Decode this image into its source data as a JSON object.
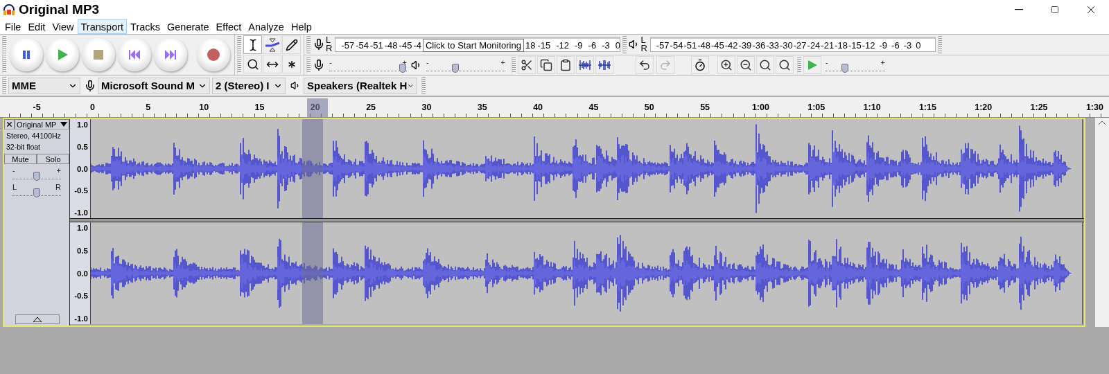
{
  "window": {
    "title": "Original MP3"
  },
  "menu": [
    {
      "label": "File",
      "selected": false
    },
    {
      "label": "Edit",
      "selected": false
    },
    {
      "label": "View",
      "selected": false
    },
    {
      "label": "Transport",
      "selected": true
    },
    {
      "label": "Tracks",
      "selected": false
    },
    {
      "label": "Generate",
      "selected": false
    },
    {
      "label": "Effect",
      "selected": false
    },
    {
      "label": "Analyze",
      "selected": false
    },
    {
      "label": "Help",
      "selected": false
    }
  ],
  "transport": [
    {
      "kind": "pause"
    },
    {
      "kind": "play"
    },
    {
      "kind": "stop"
    },
    {
      "kind": "skip-start"
    },
    {
      "kind": "skip-end"
    },
    {
      "kind": "record"
    }
  ],
  "tools": [
    {
      "kind": "select",
      "selected": true
    },
    {
      "kind": "envelope",
      "selected": false
    },
    {
      "kind": "draw",
      "selected": false
    },
    {
      "kind": "zoom",
      "selected": false
    },
    {
      "kind": "time-shift",
      "selected": false
    },
    {
      "kind": "multi",
      "selected": false
    }
  ],
  "record_meter": {
    "left": "L",
    "right": "R",
    "scale_before": [
      "-57",
      "-54",
      "-51",
      "-48",
      "-45",
      "-4"
    ],
    "tooltip": "Click to Start Monitoring",
    "scale_after": [
      "18",
      "-15",
      "-12",
      "-9",
      "-6",
      "-3",
      "0"
    ]
  },
  "playback_meter": {
    "left": "L",
    "right": "R",
    "scale": [
      "-57",
      "-54",
      "-51",
      "-48",
      "-45",
      "-42",
      "-39",
      "-36",
      "-33",
      "-30",
      "-27",
      "-24",
      "-21",
      "-18",
      "-15",
      "-12",
      "-9",
      "-6",
      "-3",
      "0"
    ]
  },
  "record_volume": {
    "min": "-",
    "max": "+",
    "level": 0.95
  },
  "playback_volume": {
    "min": "-",
    "max": "+",
    "level": 0.37
  },
  "edit_tools": [
    {
      "kind": "cut",
      "disabled": false
    },
    {
      "kind": "copy",
      "disabled": false
    },
    {
      "kind": "paste",
      "disabled": false
    },
    {
      "kind": "trim",
      "disabled": false
    },
    {
      "kind": "silence",
      "disabled": false
    }
  ],
  "history": [
    {
      "kind": "undo",
      "disabled": false
    },
    {
      "kind": "redo",
      "disabled": true
    }
  ],
  "zoom_tools": [
    {
      "kind": "zoom-in"
    },
    {
      "kind": "zoom-out"
    },
    {
      "kind": "fit-selection"
    },
    {
      "kind": "fit-project"
    }
  ],
  "play_at_speed": {
    "min": "-",
    "max": "+",
    "level": 0.33
  },
  "devices": {
    "host": "MME",
    "input": "Microsoft Sound M",
    "channels": "2 (Stereo) I",
    "output": "Speakers (Realtek H"
  },
  "timeline": {
    "labels": [
      "-5",
      "0",
      "5",
      "10",
      "15",
      "20",
      "25",
      "30",
      "35",
      "40",
      "45",
      "50",
      "55",
      "1:00",
      "1:05",
      "1:10",
      "1:15",
      "1:20",
      "1:25",
      "1:30"
    ]
  },
  "track": {
    "name": "Original MP",
    "info": [
      "Stereo, 44100Hz",
      "32-bit float"
    ],
    "mute": "Mute",
    "solo": "Solo",
    "gain": {
      "min": "-",
      "max": "+",
      "level": 0.5
    },
    "pan": {
      "min": "L",
      "max": "R",
      "level": 0.5
    },
    "channels": [
      {
        "scale": [
          "1.0",
          "0.5",
          "0.0",
          "-0.5",
          "-1.0"
        ]
      },
      {
        "scale": [
          "1.0",
          "0.5",
          "0.0",
          "-0.5",
          "-1.0"
        ]
      }
    ]
  }
}
